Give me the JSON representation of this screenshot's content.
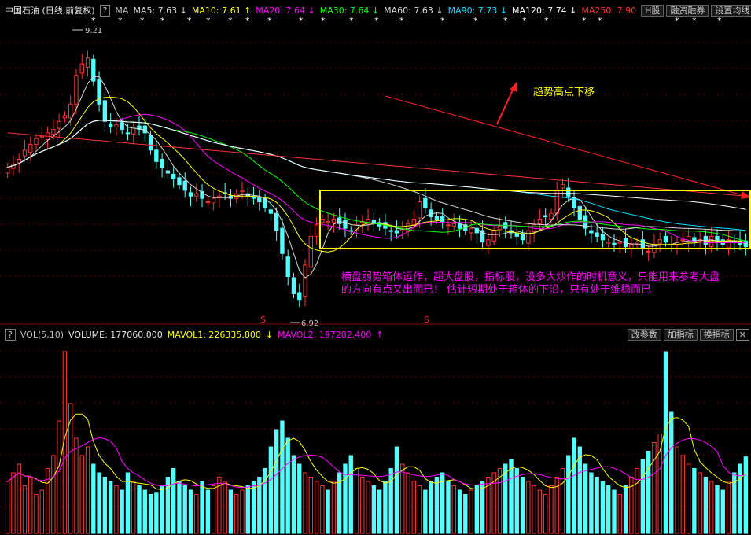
{
  "header": {
    "title": "中国石油 (日线,前复权)",
    "help_mark": "?",
    "ma_label": "MA",
    "indicators": [
      {
        "text": "MA5: 7.63",
        "arrow": "↓",
        "color": "#d8d8d8"
      },
      {
        "text": "MA10: 7.61",
        "arrow": "↑",
        "color": "#ffff00"
      },
      {
        "text": "MA20: 7.64",
        "arrow": "↓",
        "color": "#ff00ff"
      },
      {
        "text": "MA30: 7.64",
        "arrow": "↓",
        "color": "#00ff00"
      },
      {
        "text": "MA60: 7.63",
        "arrow": "↓",
        "color": "#d8d8d8"
      },
      {
        "text": "MA90: 7.73",
        "arrow": "↓",
        "color": "#00e0ff"
      },
      {
        "text": "MA120: 7.74",
        "arrow": "↓",
        "color": "#ffffff"
      },
      {
        "text": "MA250: 7.90",
        "arrow": "",
        "color": "#ff3030"
      }
    ],
    "buttons": [
      "H股",
      "融资融券",
      "设置均线"
    ]
  },
  "volume_header": {
    "help_mark": "?",
    "label": "VOL(5,10)",
    "volume": "VOLUME: 177060.000",
    "mavol1": "MAVOL1: 226335.800",
    "mavol1_arrow": "↓",
    "mavol2": "MAVOL2: 197282.400",
    "mavol2_arrow": "↑",
    "buttons": [
      "改参数",
      "加指标",
      "换指标"
    ]
  },
  "colors": {
    "up": "#ff3232",
    "down": "#54ffff",
    "ma5": "#d8d8d8",
    "ma10": "#ffff00",
    "ma20": "#ff00ff",
    "ma30": "#00ff00",
    "ma60": "#d8d8d8",
    "ma90": "#00e0ff",
    "ma120": "#ffffff",
    "ma250": "#ff3030",
    "box": "#ffff00",
    "annotation_red": "#ff2020",
    "annotation_magenta": "#ff00ff"
  },
  "annotations": {
    "trend_label": "趋势高点下移",
    "note_line1": "横盘弱势箱体运作，超大盘股，指标股，没多大炒作的时机意义，只能用来参考大盘",
    "note_line2": "的方向有点又出而已！ 估计短期处于箱体的下沿，只有处于维稳而已",
    "high_label": "9.21",
    "low_label": "6.92",
    "signal_marker": "S"
  },
  "chart_data": {
    "type": "candlestick",
    "title": "中国石油 (日线,前复权)",
    "xlabel": "",
    "ylabel": "",
    "ylim": [
      6.8,
      9.4
    ],
    "highest": 9.21,
    "lowest": 6.92,
    "close_series": [
      8.15,
      8.18,
      8.22,
      8.3,
      8.35,
      8.4,
      8.42,
      8.45,
      8.48,
      8.55,
      8.6,
      8.7,
      8.95,
      9.05,
      9.1,
      8.9,
      8.7,
      8.55,
      8.5,
      8.52,
      8.48,
      8.45,
      8.5,
      8.48,
      8.45,
      8.3,
      8.2,
      8.15,
      8.1,
      8.05,
      8.0,
      7.95,
      7.9,
      7.92,
      7.88,
      7.85,
      7.88,
      7.9,
      7.92,
      7.88,
      7.92,
      7.95,
      7.9,
      7.88,
      7.85,
      7.8,
      7.75,
      7.6,
      7.4,
      7.2,
      7.05,
      7.0,
      7.3,
      7.55,
      7.65,
      7.7,
      7.68,
      7.7,
      7.66,
      7.62,
      7.6,
      7.65,
      7.68,
      7.7,
      7.66,
      7.64,
      7.62,
      7.6,
      7.58,
      7.62,
      7.66,
      7.7,
      7.85,
      7.8,
      7.72,
      7.7,
      7.68,
      7.65,
      7.66,
      7.62,
      7.6,
      7.62,
      7.58,
      7.5,
      7.52,
      7.6,
      7.64,
      7.62,
      7.58,
      7.55,
      7.52,
      7.6,
      7.65,
      7.7,
      7.72,
      7.75,
      7.95,
      8.0,
      7.9,
      7.8,
      7.7,
      7.62,
      7.58,
      7.55,
      7.52,
      7.5,
      7.48,
      7.5,
      7.46,
      7.48,
      7.5,
      7.45,
      7.42,
      7.48,
      7.52,
      7.5,
      7.48,
      7.5,
      7.52,
      7.55,
      7.5,
      7.52,
      7.48,
      7.55,
      7.5,
      7.48,
      7.52,
      7.5,
      7.48,
      7.46
    ],
    "ma_values": {
      "MA5": 7.63,
      "MA10": 7.61,
      "MA20": 7.64,
      "MA30": 7.64,
      "MA60": 7.63,
      "MA90": 7.73,
      "MA120": 7.74,
      "MA250": 7.9
    },
    "volume": {
      "last": 177060.0,
      "mavol1": 226335.8,
      "mavol2": 197282.4,
      "series": [
        120,
        140,
        160,
        110,
        130,
        90,
        100,
        150,
        180,
        260,
        420,
        300,
        220,
        180,
        200,
        160,
        140,
        130,
        120,
        110,
        100,
        140,
        120,
        110,
        100,
        90,
        95,
        110,
        130,
        150,
        120,
        110,
        100,
        90,
        120,
        100,
        110,
        130,
        120,
        100,
        90,
        100,
        110,
        120,
        130,
        150,
        200,
        240,
        260,
        220,
        180,
        160,
        140,
        130,
        120,
        110,
        100,
        120,
        140,
        160,
        180,
        150,
        130,
        120,
        110,
        100,
        120,
        150,
        200,
        160,
        140,
        120,
        110,
        100,
        120,
        130,
        140,
        120,
        110,
        100,
        90,
        100,
        110,
        120,
        130,
        140,
        150,
        160,
        170,
        150,
        130,
        120,
        110,
        100,
        90,
        110,
        130,
        150,
        180,
        220,
        200,
        160,
        140,
        130,
        120,
        110,
        100,
        90,
        110,
        130,
        150,
        170,
        190,
        210,
        230,
        420,
        280,
        200,
        180,
        160,
        150,
        140,
        130,
        120,
        110,
        100,
        120,
        140,
        160,
        177
      ]
    }
  }
}
